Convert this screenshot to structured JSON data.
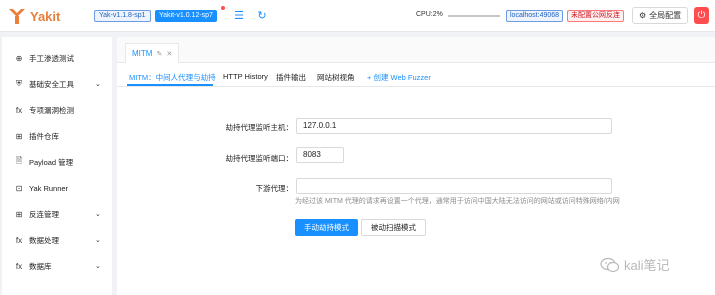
{
  "app": {
    "name": "Yakit",
    "yak_version": "Yak-v1.1.8-sp1",
    "yakit_version": "Yakit-v1.0.12-sp7"
  },
  "status": {
    "cpu": "CPU:2%",
    "host": "localhost:49068",
    "warning": "未配置公网反连",
    "global_config": "全局配置"
  },
  "sidebar": {
    "items": [
      {
        "icon": "crosshair-icon",
        "glyph": "⊕",
        "label": "手工渗透测试",
        "chevron": false
      },
      {
        "icon": "lock-icon",
        "glyph": "⛨",
        "label": "基础安全工具",
        "chevron": true
      },
      {
        "icon": "fx-icon",
        "glyph": "fx",
        "label": "专项漏洞检测",
        "chevron": false
      },
      {
        "icon": "grid-icon",
        "glyph": "⊞",
        "label": "插件仓库",
        "chevron": false
      },
      {
        "icon": "file-icon",
        "glyph": "🗎",
        "label": "Payload 管理",
        "chevron": false
      },
      {
        "icon": "terminal-icon",
        "glyph": "⊡",
        "label": "Yak Runner",
        "chevron": false
      },
      {
        "icon": "grid-icon",
        "glyph": "⊞",
        "label": "反连管理",
        "chevron": true
      },
      {
        "icon": "fx-icon",
        "glyph": "fx",
        "label": "数据处理",
        "chevron": true
      },
      {
        "icon": "fx-icon",
        "glyph": "fx",
        "label": "数据库",
        "chevron": true
      }
    ]
  },
  "main": {
    "tab": {
      "label": "MITM"
    },
    "subtabs": [
      "MITM：中间人代理与劫持",
      "HTTP History",
      "插件输出",
      "网站树视角",
      "+ 创建 Web Fuzzer"
    ],
    "form": {
      "host_label": "劫持代理监听主机：",
      "host_value": "127.0.0.1",
      "port_label": "劫持代理监听端口：",
      "port_value": "8083",
      "downstream_label": "下游代理：",
      "downstream_value": "",
      "downstream_help": "为经过该 MITM 代理的请求再设置一个代理，通常用于访问中国大陆无法访问的网站或访问特殊网络/内网",
      "manual_button": "手动劫持模式",
      "passive_button": "被动扫描模式"
    }
  },
  "watermark": {
    "text": "kali笔记"
  },
  "colors": {
    "accent": "#1890ff",
    "brand": "#e8803a",
    "danger": "#ff4d4f"
  }
}
